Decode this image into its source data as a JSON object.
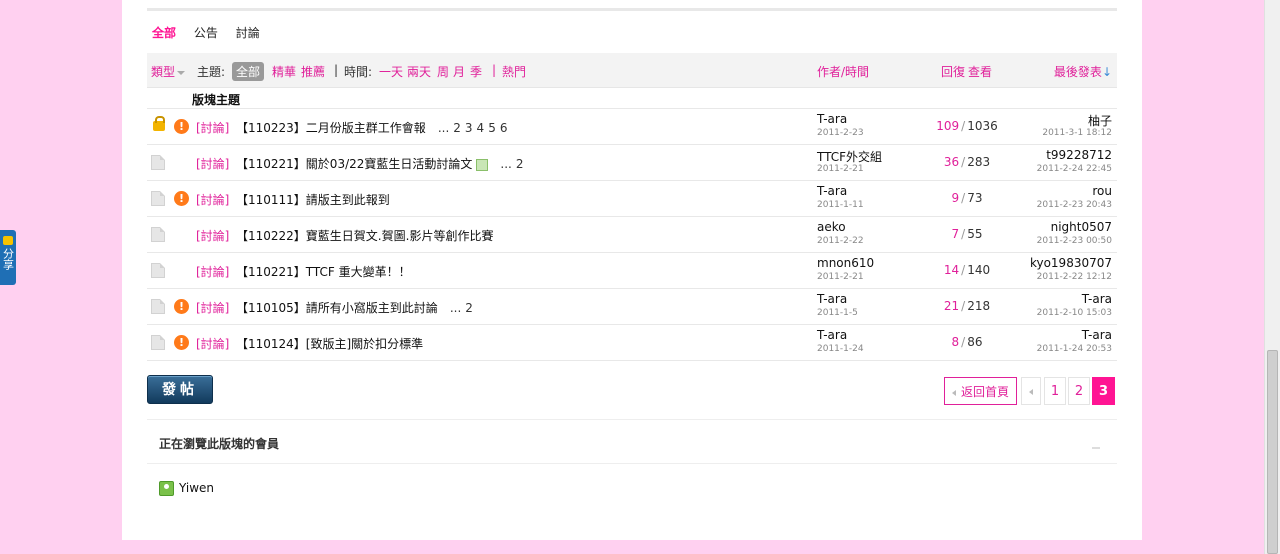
{
  "tabs": [
    "全部",
    "公告",
    "討論"
  ],
  "filter": {
    "type_label": "類型",
    "theme_label": "主題:",
    "theme_all": "全部",
    "theme_digest": "精華",
    "theme_recommend": "推薦",
    "time_label": "時間:",
    "time_one_day": "一天",
    "time_two_days": "兩天",
    "time_week": "周",
    "time_month": "月",
    "time_season": "季",
    "hot": "熱門",
    "col_author": "作者/時間",
    "col_replies": "回復",
    "col_views": "查看",
    "col_last": "最後發表"
  },
  "section_title": "版塊主題",
  "threads": [
    {
      "icon": "lock",
      "alert": true,
      "category": "[討論]",
      "title": "【110223】二月份版主群工作會報",
      "pages": [
        "2",
        "3",
        "4",
        "5",
        "6"
      ],
      "author": "T-ara",
      "date": "2011-2-23",
      "replies": "109",
      "views": "1036",
      "last_user": "柚子",
      "last_date": "2011-3-1 18:12"
    },
    {
      "icon": "doc",
      "alert": false,
      "category": "[討論]",
      "title": "【110221】關於03/22寶藍生日活動討論文",
      "has_image": true,
      "pages": [
        "2"
      ],
      "author": "TTCF外交組",
      "date": "2011-2-21",
      "replies": "36",
      "views": "283",
      "last_user": "t99228712",
      "last_date": "2011-2-24 22:45"
    },
    {
      "icon": "doc",
      "alert": true,
      "category": "[討論]",
      "title": "【110111】請版主到此報到",
      "pages": [],
      "author": "T-ara",
      "date": "2011-1-11",
      "replies": "9",
      "views": "73",
      "last_user": "rou",
      "last_date": "2011-2-23 20:43"
    },
    {
      "icon": "doc",
      "alert": false,
      "category": "[討論]",
      "title": "【110222】寶藍生日賀文.賀圖.影片等創作比賽",
      "pages": [],
      "author": "aeko",
      "date": "2011-2-22",
      "replies": "7",
      "views": "55",
      "last_user": "night0507",
      "last_date": "2011-2-23 00:50"
    },
    {
      "icon": "doc",
      "alert": false,
      "category": "[討論]",
      "title": "【110221】TTCF 重大變革！！",
      "pages": [],
      "author": "mnon610",
      "date": "2011-2-21",
      "replies": "14",
      "views": "140",
      "last_user": "kyo19830707",
      "last_date": "2011-2-22 12:12"
    },
    {
      "icon": "doc",
      "alert": true,
      "category": "[討論]",
      "title": "【110105】請所有小窩版主到此討論",
      "pages": [
        "2"
      ],
      "author": "T-ara",
      "date": "2011-1-5",
      "replies": "21",
      "views": "218",
      "last_user": "T-ara",
      "last_date": "2011-2-10 15:03"
    },
    {
      "icon": "doc",
      "alert": true,
      "category": "[討論]",
      "title": "【110124】[致版主]關於扣分標準",
      "pages": [],
      "author": "T-ara",
      "date": "2011-1-24",
      "replies": "8",
      "views": "86",
      "last_user": "T-ara",
      "last_date": "2011-1-24 20:53"
    }
  ],
  "ellipsis": "...",
  "post_button": "發帖",
  "pager": {
    "home": "返回首頁",
    "pages": [
      "1",
      "2",
      "3"
    ],
    "current": "3"
  },
  "online": {
    "title": "正在瀏覽此版塊的會員",
    "users": [
      "Yiwen"
    ]
  },
  "share_label": "分享",
  "colors": {
    "accent": "#e0209a",
    "current_page": "#ff1493",
    "background": "#ffd0f0"
  }
}
